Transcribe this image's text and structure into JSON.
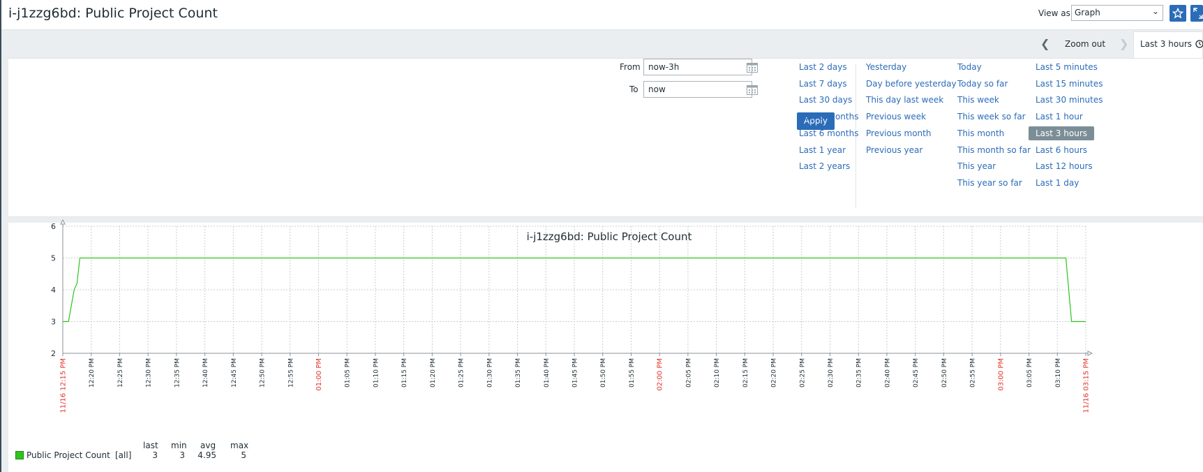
{
  "header": {
    "title": "i-j1zzg6bd: Public Project Count",
    "view_as_label": "View as",
    "view_as_value": "Graph"
  },
  "time_nav": {
    "zoom_out_label": "Zoom out",
    "active_tab_label": "Last 3 hours"
  },
  "filter": {
    "from_label": "From",
    "from_value": "now-3h",
    "to_label": "To",
    "to_value": "now",
    "apply_label": "Apply",
    "quick_ranges": [
      [
        "Last 2 days",
        "Last 7 days",
        "Last 30 days",
        "Last 3 months",
        "Last 6 months",
        "Last 1 year",
        "Last 2 years"
      ],
      [
        "Yesterday",
        "Day before yesterday",
        "This day last week",
        "Previous week",
        "Previous month",
        "Previous year"
      ],
      [
        "Today",
        "Today so far",
        "This week",
        "This week so far",
        "This month",
        "This month so far",
        "This year",
        "This year so far"
      ],
      [
        "Last 5 minutes",
        "Last 15 minutes",
        "Last 30 minutes",
        "Last 1 hour",
        "Last 3 hours",
        "Last 6 hours",
        "Last 12 hours",
        "Last 1 day"
      ]
    ],
    "selected_range": "Last 3 hours"
  },
  "chart_data": {
    "type": "line",
    "title": "i-j1zzg6bd: Public Project Count",
    "ylim": [
      2,
      6
    ],
    "yticks": [
      2,
      3,
      4,
      5,
      6
    ],
    "xlim_minutes": [
      0,
      180
    ],
    "x_tick_labels": [
      "11/16 12:15 PM",
      "12:20 PM",
      "12:25 PM",
      "12:30 PM",
      "12:35 PM",
      "12:40 PM",
      "12:45 PM",
      "12:50 PM",
      "12:55 PM",
      "01:00 PM",
      "01:05 PM",
      "01:10 PM",
      "01:15 PM",
      "01:20 PM",
      "01:25 PM",
      "01:30 PM",
      "01:35 PM",
      "01:40 PM",
      "01:45 PM",
      "01:50 PM",
      "01:55 PM",
      "02:00 PM",
      "02:05 PM",
      "02:10 PM",
      "02:15 PM",
      "02:20 PM",
      "02:25 PM",
      "02:30 PM",
      "02:35 PM",
      "02:40 PM",
      "02:45 PM",
      "02:50 PM",
      "02:55 PM",
      "03:00 PM",
      "03:05 PM",
      "03:10 PM",
      "11/16 03:15 PM"
    ],
    "x_tick_red": [
      "11/16 12:15 PM",
      "01:00 PM",
      "02:00 PM",
      "03:00 PM",
      "11/16 03:15 PM"
    ],
    "grid": true,
    "series": [
      {
        "name": "Public Project Count",
        "color": "#2ec41d",
        "x": [
          0,
          1,
          2,
          2.5,
          3,
          176.5,
          177.5,
          180
        ],
        "values": [
          3,
          3,
          4,
          4.2,
          5,
          5,
          3,
          3
        ]
      }
    ],
    "legend": {
      "headers": [
        "last",
        "min",
        "avg",
        "max"
      ],
      "rows": [
        {
          "name": "Public Project Count",
          "func": "[all]",
          "last": "3",
          "min": "3",
          "avg": "4.95",
          "max": "5"
        }
      ]
    }
  }
}
